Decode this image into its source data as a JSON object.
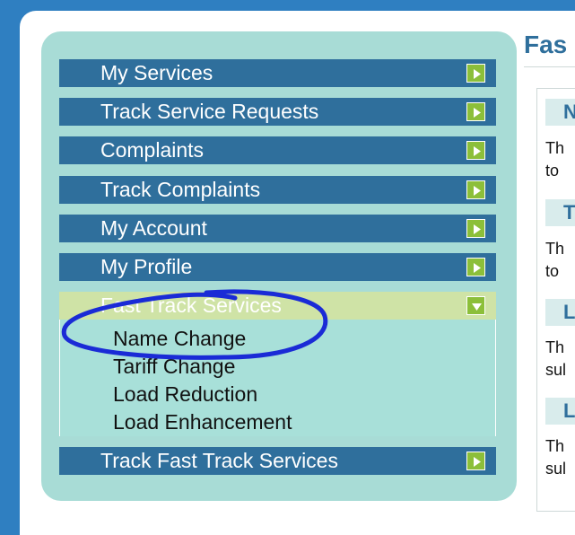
{
  "sidebar": {
    "items": [
      {
        "label": "My Services"
      },
      {
        "label": "Track Service Requests"
      },
      {
        "label": "Complaints"
      },
      {
        "label": "Track Complaints"
      },
      {
        "label": "My Account"
      },
      {
        "label": "My Profile"
      }
    ],
    "expanded": {
      "label": "Fast Track Services",
      "subitems": [
        {
          "label": "Name Change"
        },
        {
          "label": "Tariff Change"
        },
        {
          "label": "Load Reduction"
        },
        {
          "label": "Load Enhancement"
        }
      ]
    },
    "last_item": {
      "label": "Track Fast Track Services"
    }
  },
  "right": {
    "title": "Fas",
    "cards": [
      {
        "header": "N",
        "line1": "Th",
        "line2": "to"
      },
      {
        "header": "T",
        "line1": "Th",
        "line2": "to"
      },
      {
        "header": "L",
        "line1": "Th",
        "line2": "sul"
      },
      {
        "header": "L",
        "line1": "Th",
        "line2": "sul"
      }
    ]
  },
  "colors": {
    "menu_bg": "#2f6f9c",
    "expanded_bg": "#cfe3a6",
    "arrow_green": "#8cbf3a",
    "sidebar_bg": "#a8dcd6",
    "annotation_circle": "#1a2bd6",
    "outer_frame": "#2f7fc1"
  },
  "icons": {
    "collapsed": "arrow-right-icon",
    "expanded": "arrow-down-icon"
  }
}
